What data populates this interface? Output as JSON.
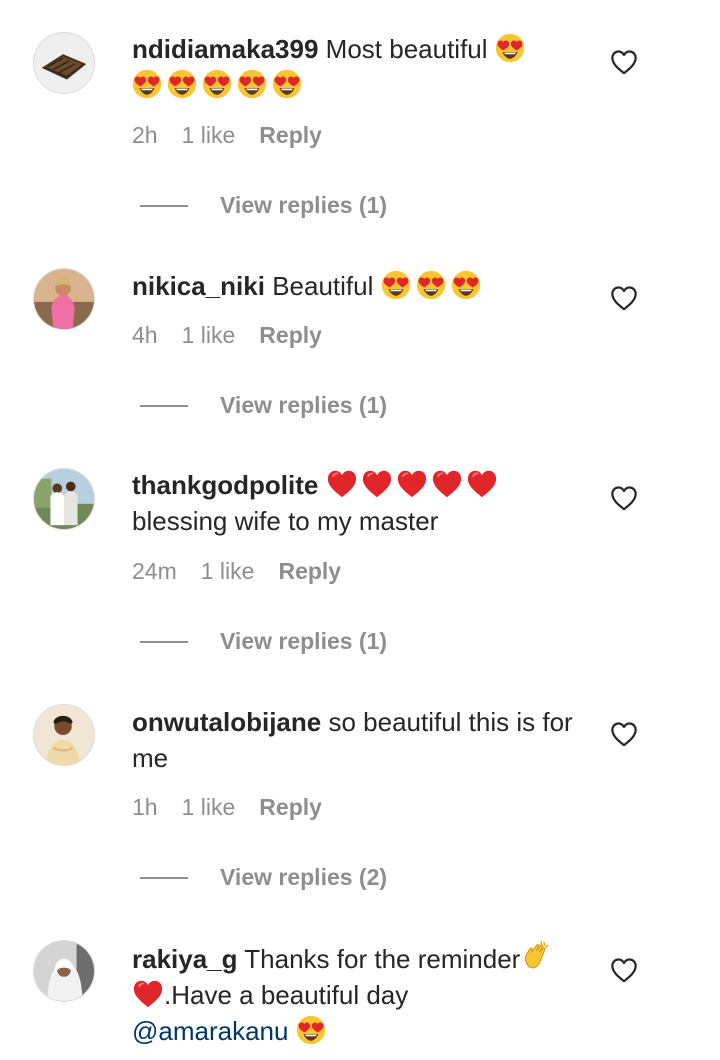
{
  "comments": [
    {
      "username": "ndidiamaka399",
      "text": "Most beautiful",
      "time": "2h",
      "likes": "1 like",
      "reply_label": "Reply",
      "view_replies": "View replies (1)"
    },
    {
      "username": "nikica_niki",
      "text": "Beautiful",
      "time": "4h",
      "likes": "1 like",
      "reply_label": "Reply",
      "view_replies": "View replies (1)"
    },
    {
      "username": "thankgodpolite",
      "text": "blessing wife to my master",
      "time": "24m",
      "likes": "1 like",
      "reply_label": "Reply",
      "view_replies": "View replies (1)"
    },
    {
      "username": "onwutalobijane",
      "text": "so beautiful this is for me",
      "time": "1h",
      "likes": "1 like",
      "reply_label": "Reply",
      "view_replies": "View replies (2)"
    },
    {
      "username": "rakiya_g",
      "text": "Thanks for the reminder",
      "text_2": ".Have a beautiful day",
      "mention": "@amarakanu"
    }
  ],
  "icons": {
    "like": "heart-outline-icon",
    "heart_eyes": "heart-eyes-emoji",
    "red_heart": "red-heart-emoji",
    "clap": "clapping-hands-emoji"
  },
  "colors": {
    "text": "#262626",
    "secondary": "#8e8e8e",
    "mention": "#00376b",
    "heart_red": "#e0262b",
    "emoji_yellow": "#f9c531"
  }
}
